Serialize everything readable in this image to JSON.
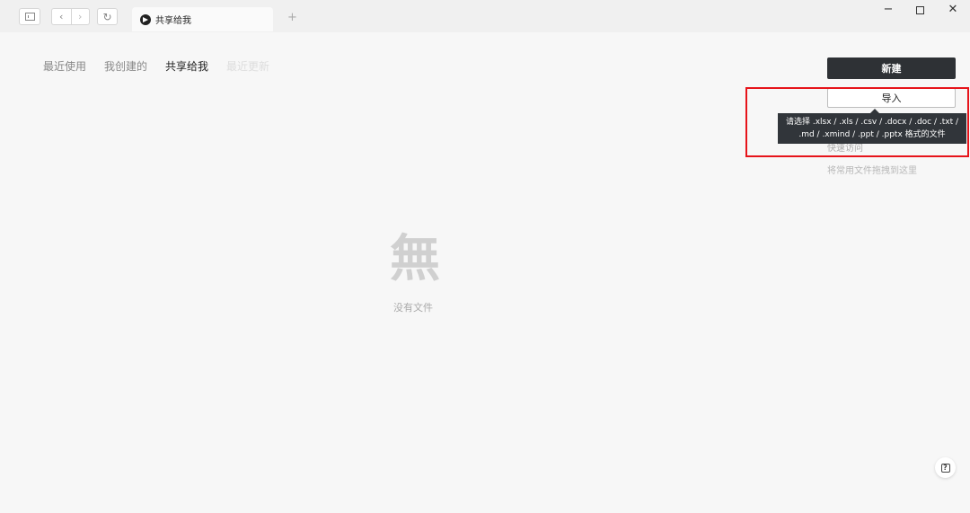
{
  "titlebar": {
    "back_glyph": "‹",
    "forward_glyph": "›",
    "reload_glyph": "↻",
    "add_tab_glyph": "+",
    "minimize_glyph": "−",
    "close_glyph": "✕"
  },
  "tab": {
    "title": "共享给我"
  },
  "nav": {
    "items": [
      {
        "label": "最近使用"
      },
      {
        "label": "我创建的"
      },
      {
        "label": "共享给我"
      },
      {
        "label": "最近更新"
      }
    ]
  },
  "actions": {
    "new_label": "新建",
    "import_label": "导入"
  },
  "tooltip": {
    "line1": "请选择 .xlsx / .xls / .csv / .docx / .doc / .txt /",
    "line2": ".md / .xmind / .ppt / .pptx 格式的文件"
  },
  "sidebar": {
    "quick_access_label": "快速访问",
    "drag_hint": "将常用文件拖拽到这里"
  },
  "empty_state": {
    "glyph": "無",
    "message": "没有文件"
  },
  "help": {
    "glyph": "?"
  },
  "colors": {
    "highlight_border": "#e6141a",
    "primary_button": "#2e3135",
    "tooltip_bg": "#31353a"
  },
  "icons": {
    "sidebar_toggle": "sidebar-toggle-icon",
    "back": "chevron-left-icon",
    "forward": "chevron-right-icon",
    "reload": "reload-icon",
    "tab_logo": "app-logo-icon",
    "help": "help-icon"
  }
}
